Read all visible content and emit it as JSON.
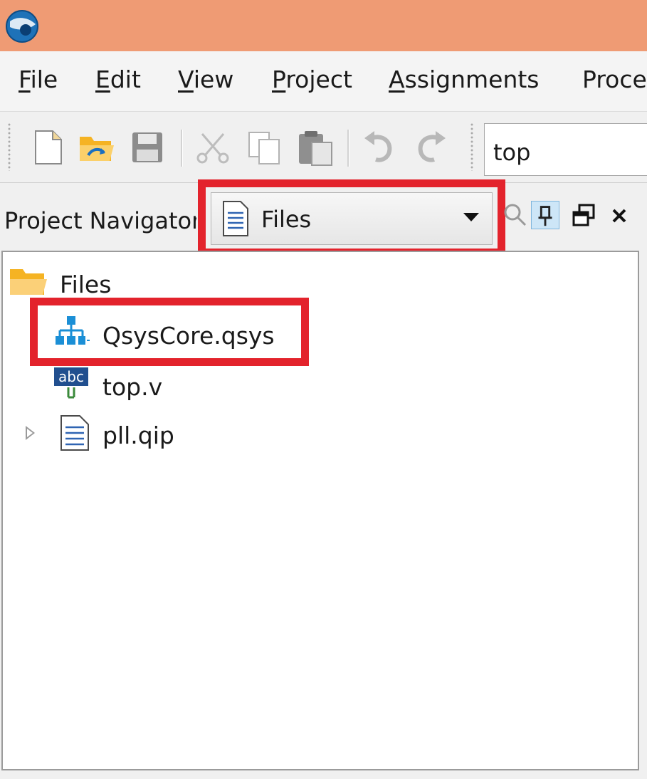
{
  "menu": {
    "items": [
      {
        "accel": "F",
        "rest": "ile"
      },
      {
        "accel": "E",
        "rest": "dit"
      },
      {
        "accel": "V",
        "rest": "iew"
      },
      {
        "accel": "P",
        "rest": "roject"
      },
      {
        "accel": "A",
        "rest": "ssignments"
      },
      {
        "accel": "",
        "rest": "Proce"
      }
    ]
  },
  "toolbar": {
    "entity_value": "top",
    "icons": [
      "new-file-icon",
      "open-file-icon",
      "save-icon",
      "cut-icon",
      "copy-icon",
      "paste-icon",
      "undo-icon",
      "redo-icon"
    ]
  },
  "panel": {
    "title": "Project Navigator",
    "view_selected": "Files",
    "icons": [
      "search-icon",
      "pin-icon",
      "float-window-icon",
      "close-icon"
    ]
  },
  "tree": {
    "root_label": "Files",
    "items": [
      {
        "label": "QsysCore.qsys",
        "icon": "qsys-system-icon"
      },
      {
        "label": "top.v",
        "icon": "verilog-file-icon"
      },
      {
        "label": "pll.qip",
        "icon": "qip-file-icon",
        "expandable": true
      }
    ]
  },
  "colors": {
    "titlebar": "#ef9b74",
    "highlight": "#e3232c",
    "folder": "#f5b323",
    "qsys_icon": "#1b8fd6"
  }
}
